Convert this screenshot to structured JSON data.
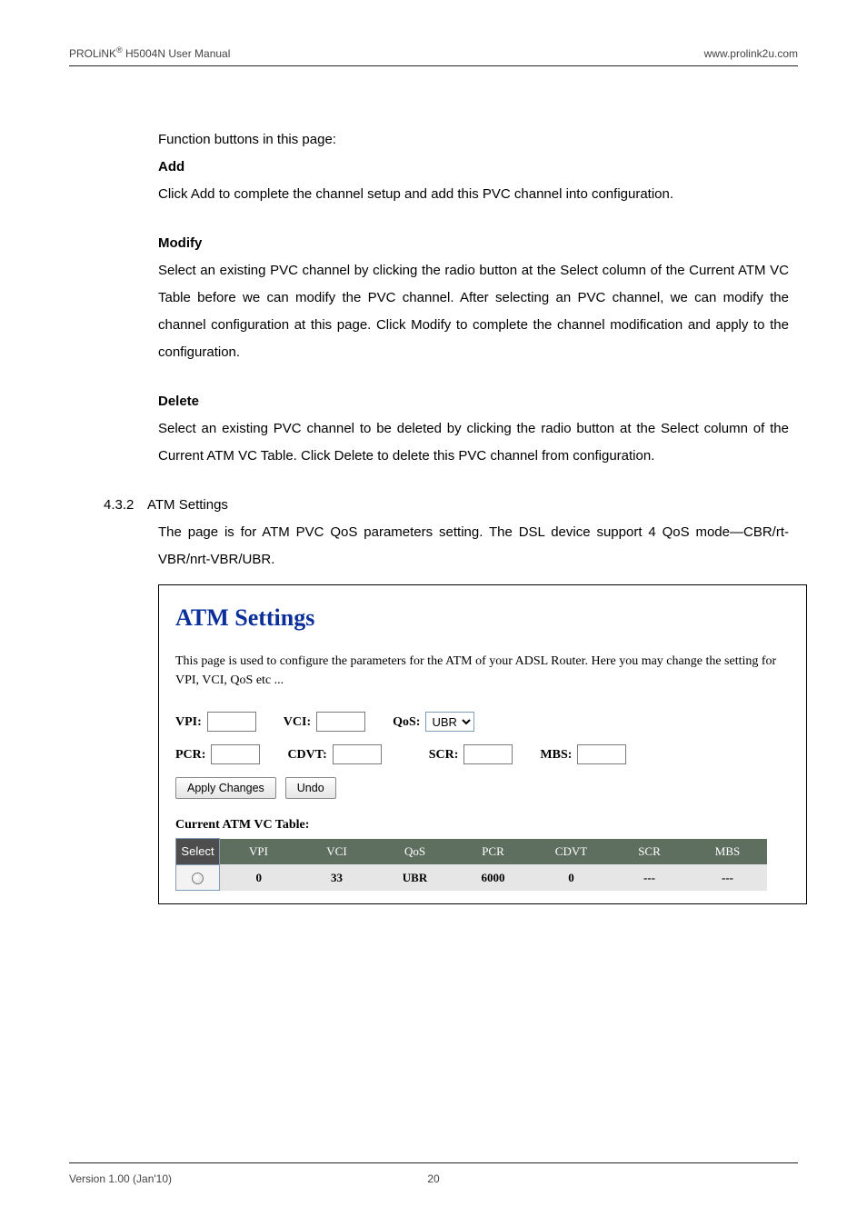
{
  "header": {
    "left_brand": "PROLiNK",
    "left_rest": " H5004N User Manual",
    "right": "www.prolink2u.com"
  },
  "body": {
    "intro": "Function buttons in this page:",
    "add_h": "Add",
    "add_p": "Click Add to complete the channel setup and add this PVC channel into configuration.",
    "mod_h": "Modify",
    "mod_p": "Select an existing PVC channel by clicking the radio button at the Select column of the Current ATM VC Table before we can modify the PVC channel. After selecting an PVC channel, we can modify the channel configuration at this page. Click Modify to complete the channel modification and apply to the configuration.",
    "del_h": "Delete",
    "del_p": "Select an existing PVC channel to be deleted by clicking the radio button at the Select column of the Current ATM VC Table. Click Delete to delete this PVC channel from configuration.",
    "sec_num": "4.3.2",
    "sec_title": "ATM Settings",
    "sec_p": "The page is for ATM PVC QoS parameters setting. The DSL device support 4 QoS mode—CBR/rt-VBR/nrt-VBR/UBR."
  },
  "shot": {
    "title": "ATM Settings",
    "desc": "This page is used to configure the parameters for the ATM of your ADSL Router. Here you may change the setting for VPI, VCI, QoS etc ...",
    "labels": {
      "vpi": "VPI:",
      "vci": "VCI:",
      "qos": "QoS:",
      "pcr": "PCR:",
      "cdvt": "CDVT:",
      "scr": "SCR:",
      "mbs": "MBS:"
    },
    "qos_selected": "UBR",
    "buttons": {
      "apply": "Apply Changes",
      "undo": "Undo"
    },
    "table_caption": "Current ATM VC Table:",
    "table": {
      "headers": {
        "select": "Select",
        "vpi": "VPI",
        "vci": "VCI",
        "qos": "QoS",
        "pcr": "PCR",
        "cdvt": "CDVT",
        "scr": "SCR",
        "mbs": "MBS"
      },
      "rows": [
        {
          "vpi": "0",
          "vci": "33",
          "qos": "UBR",
          "pcr": "6000",
          "cdvt": "0",
          "scr": "---",
          "mbs": "---"
        }
      ]
    }
  },
  "footer": {
    "left": "Version 1.00 (Jan'10)",
    "page": "20"
  }
}
